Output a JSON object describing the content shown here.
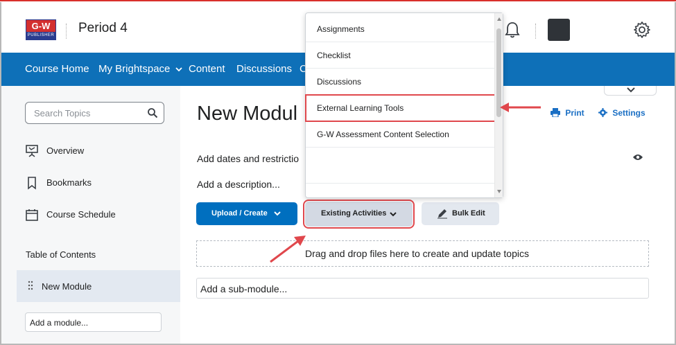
{
  "header": {
    "logo_top": "G-W",
    "logo_bottom": "PUBLISHER",
    "course_title": "Period 4",
    "bell_icon": "bell-icon",
    "gear_icon": "gear-icon"
  },
  "navbar": {
    "items": [
      "Course Home",
      "My Brightspace",
      "Content",
      "Discussions",
      "C"
    ],
    "color": "#0e70b8"
  },
  "sidebar": {
    "search_placeholder": "Search Topics",
    "items": [
      {
        "label": "Overview",
        "icon": "presentation-icon"
      },
      {
        "label": "Bookmarks",
        "icon": "bookmark-icon"
      },
      {
        "label": "Course Schedule",
        "icon": "calendar-icon"
      }
    ],
    "toc_label": "Table of Contents",
    "module_label": "New Module",
    "add_module": "Add a module..."
  },
  "main": {
    "title": "New Modul",
    "print_label": "Print",
    "settings_label": "Settings",
    "add_dates": "Add dates and restrictio",
    "add_description": "Add a description...",
    "upload_label": "Upload / Create",
    "existing_label": "Existing Activities",
    "bulk_label": "Bulk Edit",
    "dropzone_text": "Drag and drop files here to create and update topics",
    "submodule_text": "Add a sub-module..."
  },
  "dropdown": {
    "items": [
      "Assignments",
      "Checklist",
      "Discussions",
      "External Learning Tools",
      "G-W Assessment Content Selection"
    ],
    "highlighted_index": 3
  },
  "colors": {
    "accent": "#006fbf",
    "highlight_outline": "#e0474c"
  }
}
